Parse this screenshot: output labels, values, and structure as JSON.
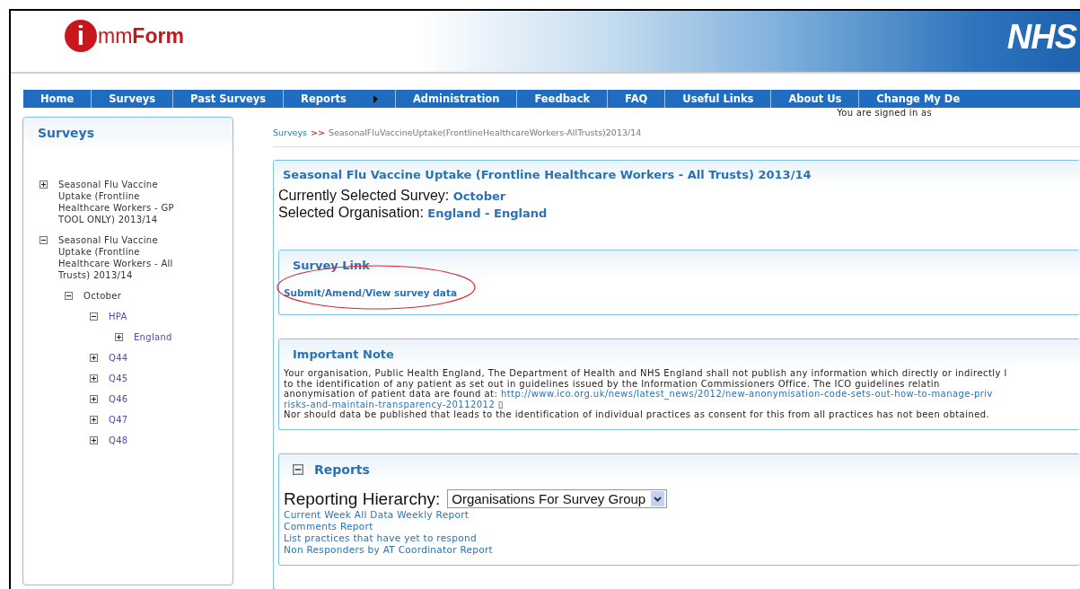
{
  "header": {
    "logo_initial": "i",
    "logo_text_light": "mm",
    "logo_text_bold": "Form",
    "brand": "NHS"
  },
  "nav": [
    {
      "label": "Home",
      "has_arrow": false
    },
    {
      "label": "Surveys",
      "has_arrow": false
    },
    {
      "label": "Past Surveys",
      "has_arrow": false
    },
    {
      "label": "Reports",
      "has_arrow": true
    },
    {
      "label": "Administration",
      "has_arrow": false
    },
    {
      "label": "Feedback",
      "has_arrow": false
    },
    {
      "label": "FAQ",
      "has_arrow": false
    },
    {
      "label": "Useful Links",
      "has_arrow": false
    },
    {
      "label": "About Us",
      "has_arrow": false
    },
    {
      "label": "Change My De",
      "has_arrow": false
    }
  ],
  "signed_in": "You are signed in as",
  "sidebar": {
    "title": "Surveys",
    "tree": [
      {
        "label": "Seasonal Flu Vaccine Uptake (Frontline Healthcare Workers - GP TOOL ONLY) 2013/14",
        "expanded": false,
        "kind": "survey"
      },
      {
        "label": "Seasonal Flu Vaccine Uptake (Frontline Healthcare Workers - All Trusts) 2013/14",
        "expanded": true,
        "kind": "survey",
        "children": [
          {
            "label": "October",
            "expanded": true,
            "kind": "period",
            "children": [
              {
                "label": "HPA",
                "expanded": true,
                "kind": "org",
                "children": [
                  {
                    "label": "England",
                    "expanded": false,
                    "kind": "org"
                  }
                ]
              },
              {
                "label": "Q44",
                "expanded": false,
                "kind": "org"
              },
              {
                "label": "Q45",
                "expanded": false,
                "kind": "org"
              },
              {
                "label": "Q46",
                "expanded": false,
                "kind": "org"
              },
              {
                "label": "Q47",
                "expanded": false,
                "kind": "org"
              },
              {
                "label": "Q48",
                "expanded": false,
                "kind": "org"
              }
            ]
          }
        ]
      }
    ]
  },
  "breadcrumb": {
    "link": "Surveys",
    "separator": ">>",
    "current": "SeasonalFluVaccineUptake(FrontlineHealthcareWorkers-AllTrusts)2013/14"
  },
  "survey_panel": {
    "title": "Seasonal Flu Vaccine Uptake (Frontline Healthcare Workers - All Trusts) 2013/14",
    "selected_survey_label": "Currently Selected Survey:",
    "selected_survey": "October",
    "selected_org_label": "Selected Organisation:",
    "selected_org": "England - England"
  },
  "survey_link": {
    "title": "Survey Link",
    "link": "Submit/Amend/View survey data"
  },
  "important_note": {
    "title": "Important Note",
    "lines": [
      [
        {
          "kind": "text",
          "text": "Your organisation, Public Health England, The Department of Health and NHS England shall not publish any information which directly or indirectly l"
        }
      ],
      [
        {
          "kind": "text",
          "text": "to the identification of any patient as set out in guidelines issued by the Information Commissioners Office. The ICO guidelines relatin"
        }
      ],
      [
        {
          "kind": "text",
          "text": "anonymisation of patient data are found at: "
        },
        {
          "kind": "link",
          "text": "http://www.ico.org.uk/news/latest_news/2012/new-anonymisation-code-sets-out-how-to-manage-priv"
        }
      ],
      [
        {
          "kind": "link",
          "text": "risks-and-maintain-transparency-20112012"
        },
        {
          "kind": "text",
          "text": " ▯"
        }
      ],
      [
        {
          "kind": "text",
          "text": "Nor should data be published that leads to the identification of individual practices as consent for this from all practices has not been obtained."
        }
      ]
    ]
  },
  "reports": {
    "title": "Reports",
    "expanded": true,
    "hierarchy_label": "Reporting Hierarchy:",
    "hierarchy_value": "Organisations For Survey Group",
    "links": [
      "Current Week All Data Weekly Report",
      "Comments Report",
      "List practices that have yet to respond",
      "Non Responders by AT Coordinator Report"
    ]
  }
}
